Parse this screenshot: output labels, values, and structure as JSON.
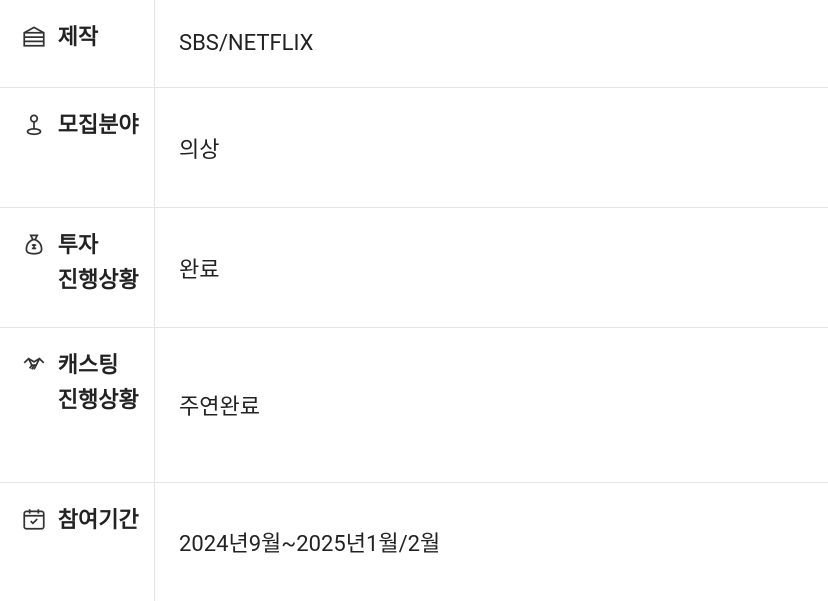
{
  "rows": [
    {
      "label": "제작",
      "value": "SBS/NETFLIX"
    },
    {
      "label": "모집분야",
      "value": "의상"
    },
    {
      "label": "투자 진행상황",
      "value": "완료"
    },
    {
      "label": "캐스팅 진행상황",
      "value": "주연완료"
    },
    {
      "label": "참여기간",
      "value": "2024년9월~2025년1월/2월"
    }
  ]
}
